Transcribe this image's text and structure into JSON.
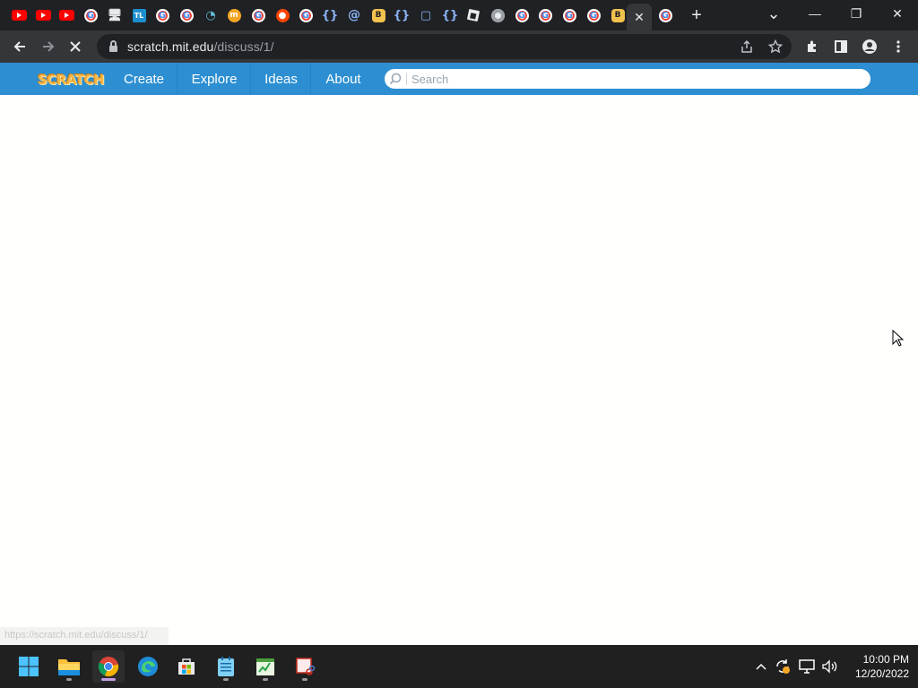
{
  "browser": {
    "tabs": [
      {
        "icon": "youtube-icon",
        "kind": "yt",
        "glyph": ""
      },
      {
        "icon": "youtube-icon",
        "kind": "yt",
        "glyph": ""
      },
      {
        "icon": "youtube-icon",
        "kind": "yt",
        "glyph": ""
      },
      {
        "icon": "google-icon",
        "kind": "g",
        "glyph": "G"
      },
      {
        "icon": "monitor-icon",
        "kind": "mon",
        "glyph": "🖥"
      },
      {
        "icon": "tl-icon",
        "kind": "tl",
        "glyph": "TL"
      },
      {
        "icon": "google-icon",
        "kind": "g",
        "glyph": "G"
      },
      {
        "icon": "google-icon",
        "kind": "g",
        "glyph": "G"
      },
      {
        "icon": "wifi-icon",
        "kind": "wifi",
        "glyph": "◔"
      },
      {
        "icon": "orange-circle-icon",
        "kind": "orange",
        "glyph": "m"
      },
      {
        "icon": "google-icon",
        "kind": "g",
        "glyph": "G"
      },
      {
        "icon": "reddit-icon",
        "kind": "reddit",
        "glyph": "●"
      },
      {
        "icon": "google-icon",
        "kind": "g",
        "glyph": "G"
      },
      {
        "icon": "code-brace-icon",
        "kind": "brace",
        "glyph": "{}"
      },
      {
        "icon": "at-sign-icon",
        "kind": "at",
        "glyph": "@"
      },
      {
        "icon": "bitcoin-icon",
        "kind": "bit",
        "glyph": "B"
      },
      {
        "icon": "code-brace-icon",
        "kind": "brace",
        "glyph": "{}"
      },
      {
        "icon": "chat-bubble-icon",
        "kind": "chat",
        "glyph": "▢"
      },
      {
        "icon": "code-brace-icon",
        "kind": "brace",
        "glyph": "{}"
      },
      {
        "icon": "roblox-icon",
        "kind": "roblox",
        "glyph": "■"
      },
      {
        "icon": "chrome-icon",
        "kind": "chrome",
        "glyph": ""
      },
      {
        "icon": "google-icon",
        "kind": "g",
        "glyph": "G"
      },
      {
        "icon": "google-icon",
        "kind": "g",
        "glyph": "G"
      },
      {
        "icon": "google-icon",
        "kind": "g",
        "glyph": "G"
      },
      {
        "icon": "google-icon",
        "kind": "g",
        "glyph": "G"
      },
      {
        "icon": "bitcoin-icon",
        "kind": "bit",
        "glyph": "B"
      },
      {
        "icon": "bitcoin-icon",
        "kind": "bit",
        "glyph": "B"
      }
    ],
    "active_tab_close": "✕",
    "new_tab_glyph": "+",
    "window_controls": {
      "dropdown": "⌄",
      "minimize": "—",
      "restore": "❐",
      "close": "✕"
    },
    "url_host": "scratch.mit.edu",
    "url_path": "/discuss/1/"
  },
  "scratch": {
    "logo_text": "SCRATCH",
    "nav": [
      "Create",
      "Explore",
      "Ideas",
      "About"
    ],
    "search_placeholder": "Search",
    "colors": {
      "nav_blue": "#2d8fd2",
      "logo_orange": "#f6b645"
    }
  },
  "status_tip": "https://scratch.mit.edu/discuss/1/",
  "taskbar": {
    "apps": [
      {
        "name": "windows-start-icon"
      },
      {
        "name": "file-explorer-icon"
      },
      {
        "name": "chrome-icon"
      },
      {
        "name": "edge-icon"
      },
      {
        "name": "microsoft-store-icon"
      },
      {
        "name": "notepad-icon"
      },
      {
        "name": "spreadsheet-icon"
      },
      {
        "name": "snipping-tool-icon"
      }
    ],
    "time": "10:00 PM",
    "date": "12/20/2022"
  }
}
